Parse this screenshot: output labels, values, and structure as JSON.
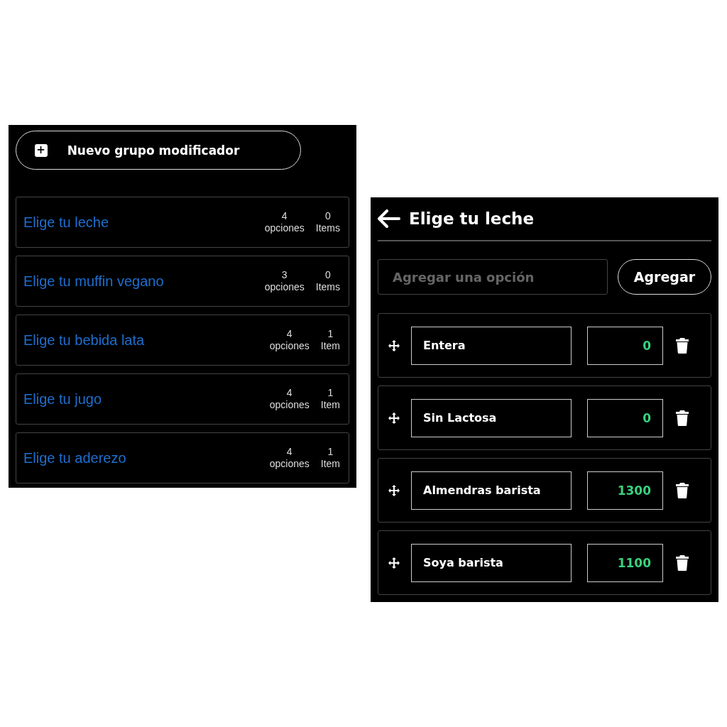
{
  "groups_panel": {
    "new_button": {
      "icon": "+",
      "label": "Nuevo grupo modificador"
    },
    "groups": [
      {
        "name": "Elige tu leche",
        "options_count": "4",
        "options_label": "opciones",
        "items_count": "0",
        "items_label": "Items"
      },
      {
        "name": "Elige tu muffin vegano",
        "options_count": "3",
        "options_label": "opciones",
        "items_count": "0",
        "items_label": "Items"
      },
      {
        "name": "Elige tu bebida lata",
        "options_count": "4",
        "options_label": "opciones",
        "items_count": "1",
        "items_label": "Item"
      },
      {
        "name": "Elige tu jugo",
        "options_count": "4",
        "options_label": "opciones",
        "items_count": "1",
        "items_label": "Item"
      },
      {
        "name": "Elige tu aderezo",
        "options_count": "4",
        "options_label": "opciones",
        "items_count": "1",
        "items_label": "Item"
      }
    ]
  },
  "detail_panel": {
    "title": "Elige tu leche",
    "add_field": {
      "placeholder": "Agregar una opción"
    },
    "add_button": "Agregar",
    "options": [
      {
        "name": "Entera",
        "price": "0"
      },
      {
        "name": "Sin Lactosa",
        "price": "0"
      },
      {
        "name": "Almendras barista",
        "price": "1300"
      },
      {
        "name": "Soya barista",
        "price": "1100"
      }
    ]
  }
}
